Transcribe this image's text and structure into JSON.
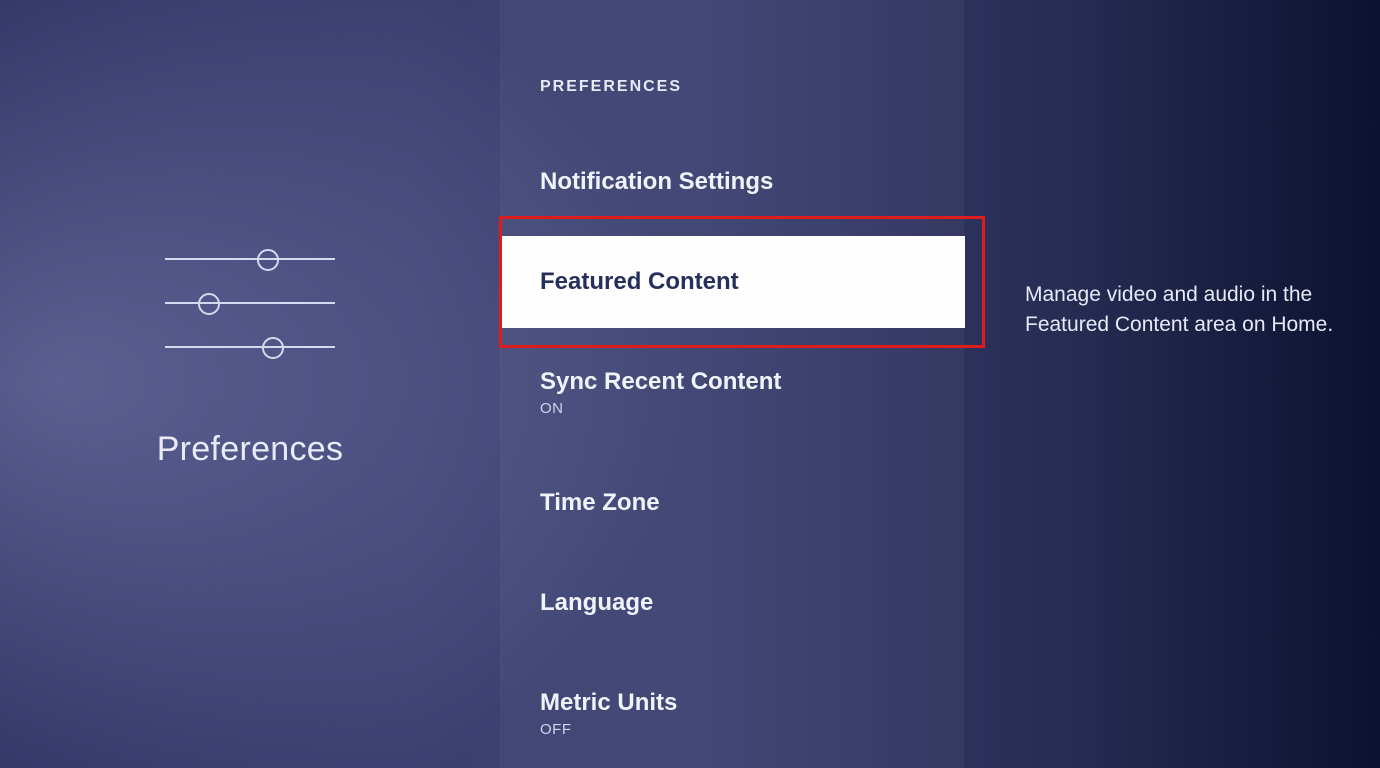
{
  "left": {
    "title": "Preferences"
  },
  "mid": {
    "header": "PREFERENCES",
    "items": [
      {
        "title": "Notification Settings",
        "subtitle": ""
      },
      {
        "title": "Featured Content",
        "subtitle": ""
      },
      {
        "title": "Sync Recent Content",
        "subtitle": "ON"
      },
      {
        "title": "Time Zone",
        "subtitle": ""
      },
      {
        "title": "Language",
        "subtitle": ""
      },
      {
        "title": "Metric Units",
        "subtitle": "OFF"
      }
    ]
  },
  "right": {
    "description": "Manage video and audio in the Featured Content area on Home."
  }
}
